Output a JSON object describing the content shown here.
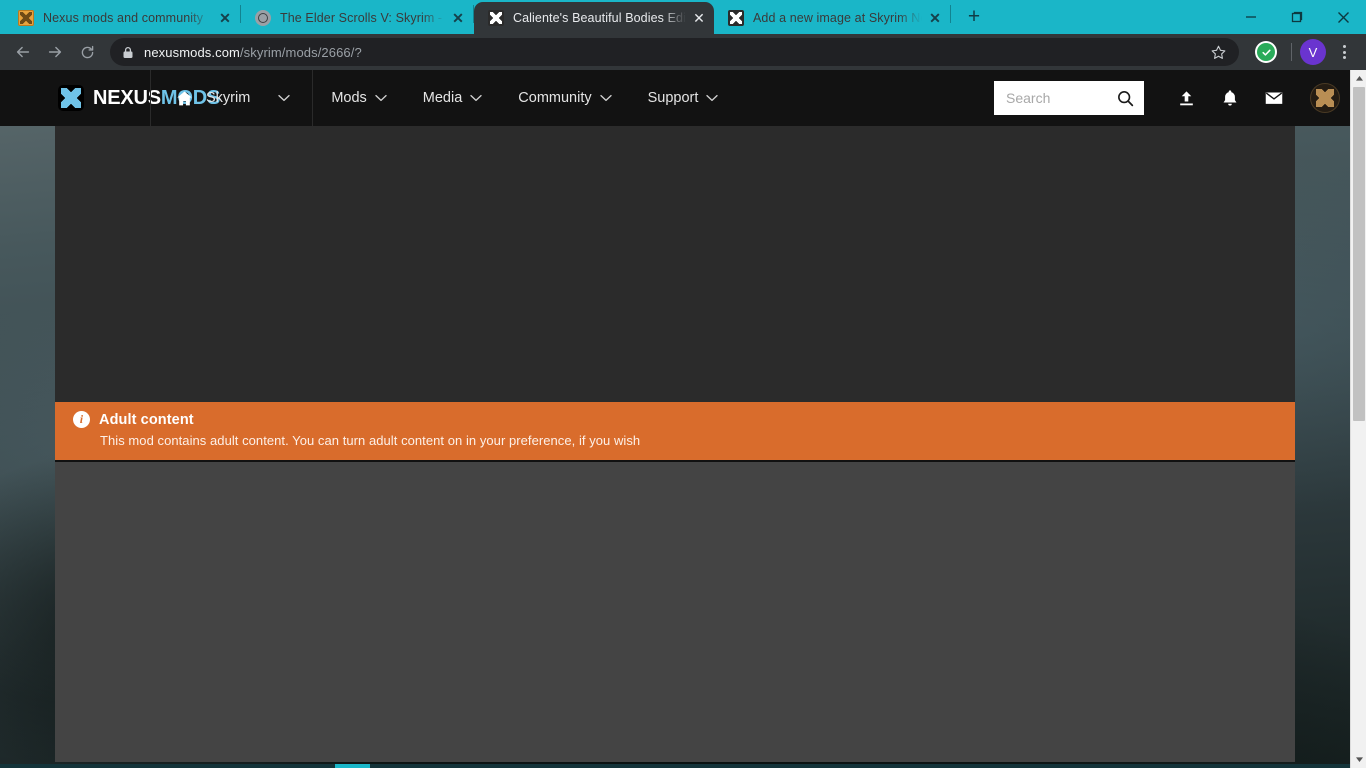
{
  "browser": {
    "tabs": [
      {
        "title": "Nexus mods and community",
        "favicon": "nexus-gold-icon",
        "active": false
      },
      {
        "title": "The Elder Scrolls V: Skyrim - Mod",
        "favicon": "globe-icon",
        "active": false
      },
      {
        "title": "Caliente's Beautiful Bodies Edition",
        "favicon": "nexus-blue-icon",
        "active": true
      },
      {
        "title": "Add a new image at Skyrim Nexu",
        "favicon": "nexus-blue-icon",
        "active": false
      }
    ],
    "new_tab_label": "+",
    "tab_close_label": "✕",
    "window_controls": {
      "minimize": "minimize-icon",
      "maximize": "maximize-icon",
      "close": "close-icon"
    },
    "toolbar": {
      "back": "back-arrow-icon",
      "forward": "forward-arrow-icon",
      "reload": "reload-icon",
      "lock": "lock-icon",
      "url_domain": "nexusmods.com",
      "url_path": "/skyrim/mods/2666/?",
      "bookmark": "star-icon",
      "extension": "green-check-extension-icon",
      "profile_initial": "V",
      "menu": "three-dot-menu-icon"
    },
    "accent_color": "#1ab6c8"
  },
  "site": {
    "logo": {
      "prefix": "NEXUS",
      "suffix": "MODS",
      "accent": "#6fc3e8"
    },
    "nav": [
      {
        "label": "Skyrim",
        "icon": "home-icon",
        "caret": true
      },
      {
        "label": "Mods",
        "caret": true
      },
      {
        "label": "Media",
        "caret": true
      },
      {
        "label": "Community",
        "caret": true
      },
      {
        "label": "Support",
        "caret": true
      }
    ],
    "search": {
      "placeholder": "Search",
      "value": "",
      "icon": "search-icon"
    },
    "header_icons": [
      {
        "name": "upload-icon"
      },
      {
        "name": "notifications-bell-icon"
      },
      {
        "name": "messages-envelope-icon"
      }
    ],
    "avatar": "user-avatar"
  },
  "banner": {
    "icon": "info-icon",
    "icon_glyph": "i",
    "title": "Adult content",
    "message": "This mod contains adult content. You can turn adult content on in your preference, if you wish",
    "background": "#d96c2c"
  },
  "page": {
    "panel_top_color": "#2b2b2b",
    "panel_bottom_color": "#444444",
    "loading_bar_color": "#1ab6c8"
  }
}
